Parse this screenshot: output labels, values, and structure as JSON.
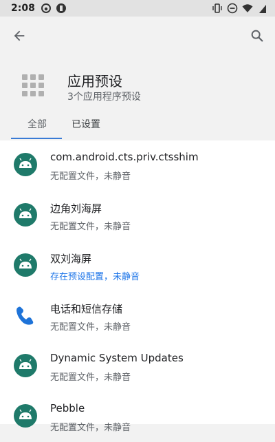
{
  "status_bar": {
    "time": "2:08"
  },
  "header": {
    "title": "应用预设",
    "subtitle": "3个应用程序预设"
  },
  "tabs": [
    {
      "label": "全部",
      "selected": true
    },
    {
      "label": "已设置",
      "selected": false
    }
  ],
  "apps": [
    {
      "name": "com.android.cts.priv.ctsshim",
      "status": "无配置文件，未静音",
      "icon": "android-icon"
    },
    {
      "name": "边角刘海屏",
      "status": "无配置文件，未静音",
      "icon": "android-icon"
    },
    {
      "name": "双刘海屏",
      "status": "存在预设配置，未静音",
      "icon": "android-icon"
    },
    {
      "name": "电话和短信存储",
      "status": "无配置文件，未静音",
      "icon": "phone-icon"
    },
    {
      "name": "Dynamic System Updates",
      "status": "无配置文件，未静音",
      "icon": "android-icon"
    },
    {
      "name": "Pebble",
      "status": "无配置文件，未静音",
      "icon": "android-icon"
    }
  ],
  "colors": {
    "accent": "#1a73e8",
    "android_icon_bg": "#1f7a6a",
    "tab_indicator": "#3a7bd5"
  }
}
